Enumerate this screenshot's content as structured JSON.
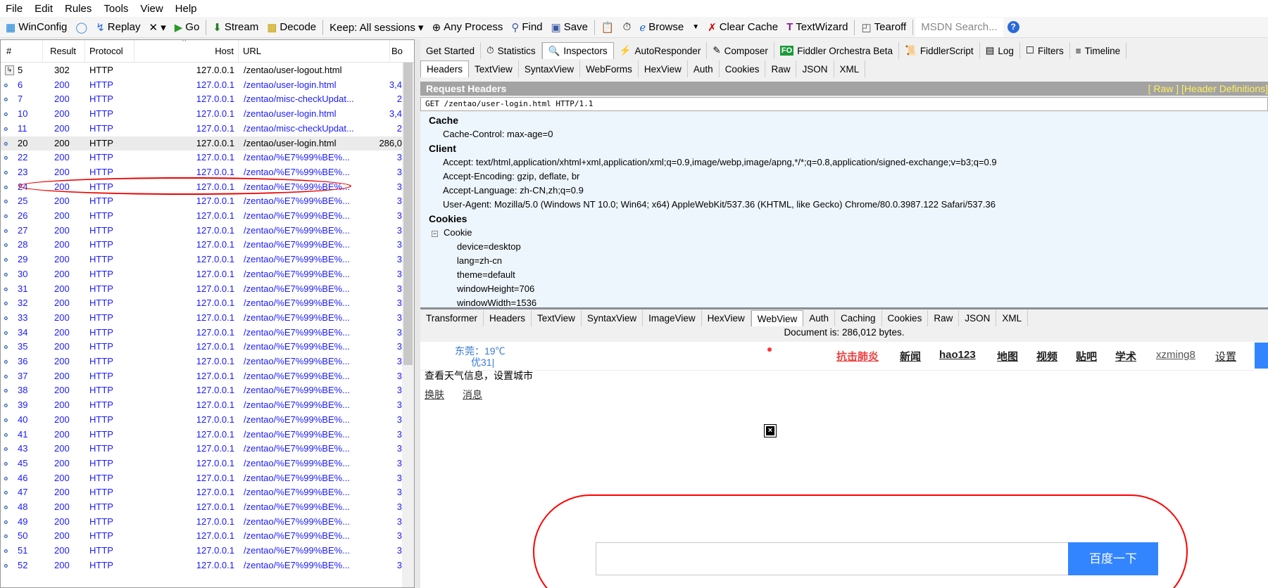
{
  "menu": [
    "File",
    "Edit",
    "Rules",
    "Tools",
    "View",
    "Help"
  ],
  "toolbar": {
    "winconfig": "WinConfig",
    "replay": "Replay",
    "remove": "✕ ▾",
    "go": "Go",
    "stream": "Stream",
    "decode": "Decode",
    "keep": "Keep: All sessions ▾",
    "any_process": "Any Process",
    "find": "Find",
    "save": "Save",
    "browse": "Browse",
    "clear_cache": "Clear Cache",
    "textwizard": "TextWizard",
    "tearoff": "Tearoff",
    "msdn_placeholder": "MSDN Search..."
  },
  "sessions": {
    "columns": [
      "#",
      "Result",
      "Protocol",
      "Host",
      "URL",
      "Bo"
    ],
    "rows": [
      {
        "id": "5",
        "result": "302",
        "protocol": "HTTP",
        "host": "127.0.0.1",
        "url": "/zentao/user-logout.html",
        "body": "",
        "style": "plain"
      },
      {
        "id": "6",
        "result": "200",
        "protocol": "HTTP",
        "host": "127.0.0.1",
        "url": "/zentao/user-login.html",
        "body": "3,4"
      },
      {
        "id": "7",
        "result": "200",
        "protocol": "HTTP",
        "host": "127.0.0.1",
        "url": "/zentao/misc-checkUpdat...",
        "body": "2"
      },
      {
        "id": "10",
        "result": "200",
        "protocol": "HTTP",
        "host": "127.0.0.1",
        "url": "/zentao/user-login.html",
        "body": "3,4"
      },
      {
        "id": "11",
        "result": "200",
        "protocol": "HTTP",
        "host": "127.0.0.1",
        "url": "/zentao/misc-checkUpdat...",
        "body": "2"
      },
      {
        "id": "20",
        "result": "200",
        "protocol": "HTTP",
        "host": "127.0.0.1",
        "url": "/zentao/user-login.html",
        "body": "286,0",
        "style": "sel"
      },
      {
        "id": "22",
        "result": "200",
        "protocol": "HTTP",
        "host": "127.0.0.1",
        "url": "/zentao/%E7%99%BE%...",
        "body": "3"
      },
      {
        "id": "23",
        "result": "200",
        "protocol": "HTTP",
        "host": "127.0.0.1",
        "url": "/zentao/%E7%99%BE%...",
        "body": "3"
      },
      {
        "id": "24",
        "result": "200",
        "protocol": "HTTP",
        "host": "127.0.0.1",
        "url": "/zentao/%E7%99%BE%...",
        "body": "3"
      },
      {
        "id": "25",
        "result": "200",
        "protocol": "HTTP",
        "host": "127.0.0.1",
        "url": "/zentao/%E7%99%BE%...",
        "body": "3"
      },
      {
        "id": "26",
        "result": "200",
        "protocol": "HTTP",
        "host": "127.0.0.1",
        "url": "/zentao/%E7%99%BE%...",
        "body": "3"
      },
      {
        "id": "27",
        "result": "200",
        "protocol": "HTTP",
        "host": "127.0.0.1",
        "url": "/zentao/%E7%99%BE%...",
        "body": "3"
      },
      {
        "id": "28",
        "result": "200",
        "protocol": "HTTP",
        "host": "127.0.0.1",
        "url": "/zentao/%E7%99%BE%...",
        "body": "3"
      },
      {
        "id": "29",
        "result": "200",
        "protocol": "HTTP",
        "host": "127.0.0.1",
        "url": "/zentao/%E7%99%BE%...",
        "body": "3"
      },
      {
        "id": "30",
        "result": "200",
        "protocol": "HTTP",
        "host": "127.0.0.1",
        "url": "/zentao/%E7%99%BE%...",
        "body": "3"
      },
      {
        "id": "31",
        "result": "200",
        "protocol": "HTTP",
        "host": "127.0.0.1",
        "url": "/zentao/%E7%99%BE%...",
        "body": "3"
      },
      {
        "id": "32",
        "result": "200",
        "protocol": "HTTP",
        "host": "127.0.0.1",
        "url": "/zentao/%E7%99%BE%...",
        "body": "3"
      },
      {
        "id": "33",
        "result": "200",
        "protocol": "HTTP",
        "host": "127.0.0.1",
        "url": "/zentao/%E7%99%BE%...",
        "body": "3"
      },
      {
        "id": "34",
        "result": "200",
        "protocol": "HTTP",
        "host": "127.0.0.1",
        "url": "/zentao/%E7%99%BE%...",
        "body": "3"
      },
      {
        "id": "35",
        "result": "200",
        "protocol": "HTTP",
        "host": "127.0.0.1",
        "url": "/zentao/%E7%99%BE%...",
        "body": "3"
      },
      {
        "id": "36",
        "result": "200",
        "protocol": "HTTP",
        "host": "127.0.0.1",
        "url": "/zentao/%E7%99%BE%...",
        "body": "3"
      },
      {
        "id": "37",
        "result": "200",
        "protocol": "HTTP",
        "host": "127.0.0.1",
        "url": "/zentao/%E7%99%BE%...",
        "body": "3"
      },
      {
        "id": "38",
        "result": "200",
        "protocol": "HTTP",
        "host": "127.0.0.1",
        "url": "/zentao/%E7%99%BE%...",
        "body": "3"
      },
      {
        "id": "39",
        "result": "200",
        "protocol": "HTTP",
        "host": "127.0.0.1",
        "url": "/zentao/%E7%99%BE%...",
        "body": "3"
      },
      {
        "id": "40",
        "result": "200",
        "protocol": "HTTP",
        "host": "127.0.0.1",
        "url": "/zentao/%E7%99%BE%...",
        "body": "3"
      },
      {
        "id": "41",
        "result": "200",
        "protocol": "HTTP",
        "host": "127.0.0.1",
        "url": "/zentao/%E7%99%BE%...",
        "body": "3"
      },
      {
        "id": "43",
        "result": "200",
        "protocol": "HTTP",
        "host": "127.0.0.1",
        "url": "/zentao/%E7%99%BE%...",
        "body": "3"
      },
      {
        "id": "45",
        "result": "200",
        "protocol": "HTTP",
        "host": "127.0.0.1",
        "url": "/zentao/%E7%99%BE%...",
        "body": "3"
      },
      {
        "id": "46",
        "result": "200",
        "protocol": "HTTP",
        "host": "127.0.0.1",
        "url": "/zentao/%E7%99%BE%...",
        "body": "3"
      },
      {
        "id": "47",
        "result": "200",
        "protocol": "HTTP",
        "host": "127.0.0.1",
        "url": "/zentao/%E7%99%BE%...",
        "body": "3"
      },
      {
        "id": "48",
        "result": "200",
        "protocol": "HTTP",
        "host": "127.0.0.1",
        "url": "/zentao/%E7%99%BE%...",
        "body": "3"
      },
      {
        "id": "49",
        "result": "200",
        "protocol": "HTTP",
        "host": "127.0.0.1",
        "url": "/zentao/%E7%99%BE%...",
        "body": "3"
      },
      {
        "id": "50",
        "result": "200",
        "protocol": "HTTP",
        "host": "127.0.0.1",
        "url": "/zentao/%E7%99%BE%...",
        "body": "3"
      },
      {
        "id": "51",
        "result": "200",
        "protocol": "HTTP",
        "host": "127.0.0.1",
        "url": "/zentao/%E7%99%BE%...",
        "body": "3"
      },
      {
        "id": "52",
        "result": "200",
        "protocol": "HTTP",
        "host": "127.0.0.1",
        "url": "/zentao/%E7%99%BE%...",
        "body": "3"
      }
    ]
  },
  "main_tabs": [
    {
      "label": "Get Started",
      "icon": ""
    },
    {
      "label": "Statistics",
      "icon": "⏱"
    },
    {
      "label": "Inspectors",
      "icon": "🔍",
      "active": true
    },
    {
      "label": "AutoResponder",
      "icon": "⚡"
    },
    {
      "label": "Composer",
      "icon": "✎"
    },
    {
      "label": "Fiddler Orchestra Beta",
      "icon": "FO"
    },
    {
      "label": "FiddlerScript",
      "icon": "📜"
    },
    {
      "label": "Log",
      "icon": "▤"
    },
    {
      "label": "Filters",
      "icon": "☐"
    },
    {
      "label": "Timeline",
      "icon": "≡"
    }
  ],
  "request_tabs": [
    {
      "label": "Headers",
      "active": true
    },
    {
      "label": "TextView"
    },
    {
      "label": "SyntaxView"
    },
    {
      "label": "WebForms"
    },
    {
      "label": "HexView"
    },
    {
      "label": "Auth"
    },
    {
      "label": "Cookies"
    },
    {
      "label": "Raw"
    },
    {
      "label": "JSON"
    },
    {
      "label": "XML"
    }
  ],
  "request_headers": {
    "title": "Request Headers",
    "links": "[ Raw ]   [Header Definitions]",
    "request_line": "GET /zentao/user-login.html HTTP/1.1",
    "lines": [
      {
        "text": "Cache",
        "kind": "grp"
      },
      {
        "text": "Cache-Control: max-age=0",
        "kind": "h"
      },
      {
        "text": "Client",
        "kind": "grp"
      },
      {
        "text": "Accept: text/html,application/xhtml+xml,application/xml;q=0.9,image/webp,image/apng,*/*;q=0.8,application/signed-exchange;v=b3;q=0.9",
        "kind": "h"
      },
      {
        "text": "Accept-Encoding: gzip, deflate, br",
        "kind": "h"
      },
      {
        "text": "Accept-Language: zh-CN,zh;q=0.9",
        "kind": "h"
      },
      {
        "text": "User-Agent: Mozilla/5.0 (Windows NT 10.0; Win64; x64) AppleWebKit/537.36 (KHTML, like Gecko) Chrome/80.0.3987.122 Safari/537.36",
        "kind": "h"
      },
      {
        "text": "Cookies",
        "kind": "grp"
      },
      {
        "text": "Cookie",
        "kind": "tree"
      },
      {
        "text": "device=desktop",
        "kind": "c"
      },
      {
        "text": "lang=zh-cn",
        "kind": "c"
      },
      {
        "text": "theme=default",
        "kind": "c"
      },
      {
        "text": "windowHeight=706",
        "kind": "c"
      },
      {
        "text": "windowWidth=1536",
        "kind": "c"
      }
    ]
  },
  "response_tabs": [
    {
      "label": "Transformer"
    },
    {
      "label": "Headers"
    },
    {
      "label": "TextView"
    },
    {
      "label": "SyntaxView"
    },
    {
      "label": "ImageView"
    },
    {
      "label": "HexView"
    },
    {
      "label": "WebView",
      "active": true
    },
    {
      "label": "Auth"
    },
    {
      "label": "Caching"
    },
    {
      "label": "Cookies"
    },
    {
      "label": "Raw"
    },
    {
      "label": "JSON"
    },
    {
      "label": "XML"
    }
  ],
  "document_info": "Document is: 286,012 bytes.",
  "webview": {
    "weather": "东莞：19℃",
    "aqi": "优31|",
    "weather_link": "查看天气信息，设置城市",
    "skin": "换肤",
    "messages": "消息",
    "nav": [
      "抗击肺炎",
      "新闻",
      "hao123",
      "地图",
      "视频",
      "贴吧",
      "学术",
      "xzming8",
      "设置"
    ],
    "search_button": "百度一下",
    "search_value": ""
  },
  "colors": {
    "accent_blue": "#3385ff",
    "session_blue": "#1a1aff",
    "highlight_red": "#e00000",
    "header_bar": "#a3a3a3"
  }
}
